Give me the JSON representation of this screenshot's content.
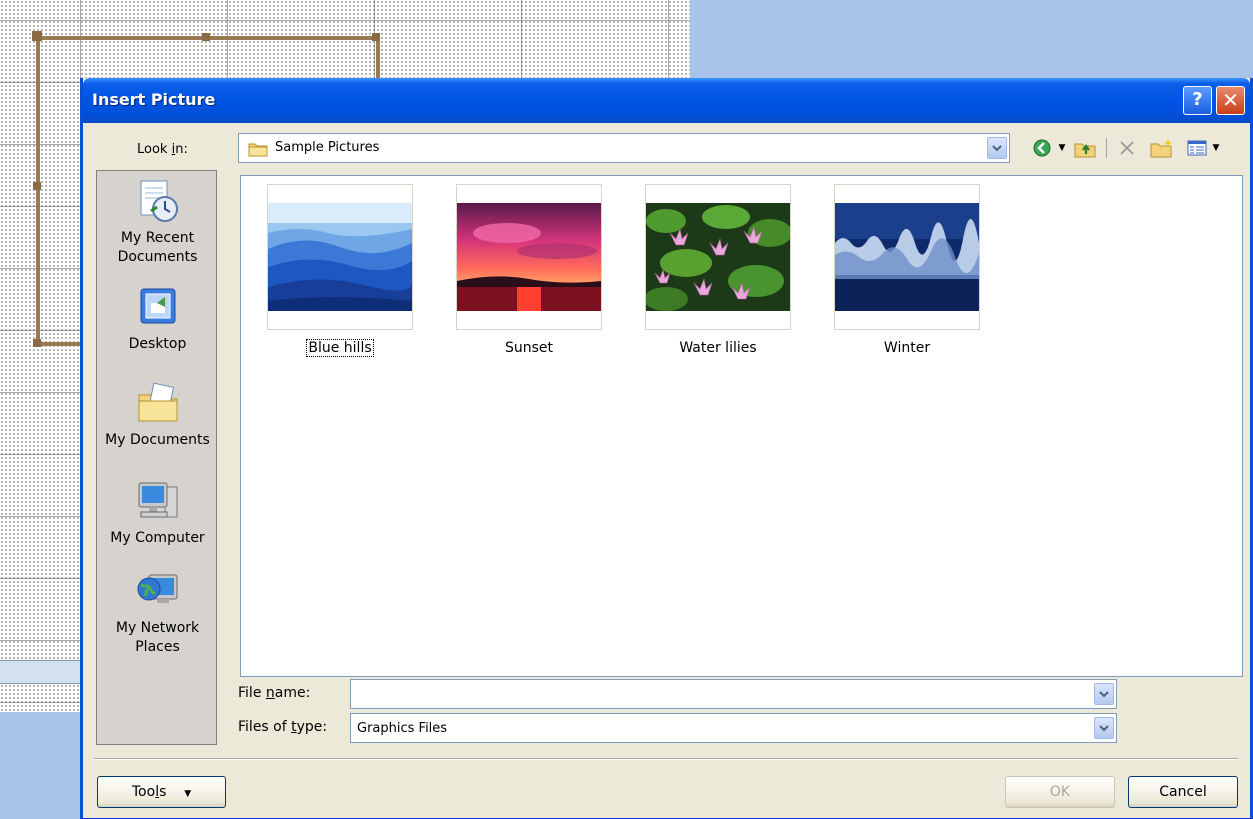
{
  "dialog": {
    "title": "Insert Picture",
    "help_glyph": "?",
    "close_glyph": "✕"
  },
  "lookin": {
    "label_pre": "Look ",
    "label_u": "i",
    "label_post": "n:",
    "value": "Sample Pictures",
    "folder_icon": "folder-icon"
  },
  "toolbar": {
    "items": [
      "back-icon",
      "up-folder-icon",
      "delete-icon",
      "new-folder-icon",
      "views-icon"
    ]
  },
  "places": [
    {
      "label": "My Recent Documents",
      "icon": "recent-documents-icon"
    },
    {
      "label": "Desktop",
      "icon": "desktop-icon"
    },
    {
      "label": "My Documents",
      "icon": "my-documents-icon"
    },
    {
      "label": "My Computer",
      "icon": "my-computer-icon"
    },
    {
      "label": "My Network Places",
      "icon": "network-places-icon"
    }
  ],
  "files": [
    {
      "name": "Blue hills",
      "selected": true
    },
    {
      "name": "Sunset",
      "selected": false
    },
    {
      "name": "Water lilies",
      "selected": false
    },
    {
      "name": "Winter",
      "selected": false
    }
  ],
  "filename": {
    "label_pre": "File ",
    "label_u": "n",
    "label_post": "ame:",
    "value": ""
  },
  "filetype": {
    "label_pre": "Files of ",
    "label_u": "t",
    "label_post": "ype:",
    "value": "Graphics Files"
  },
  "buttons": {
    "tools_pre": "Too",
    "tools_u": "l",
    "tools_post": "s",
    "ok": "OK",
    "cancel": "Cancel"
  }
}
